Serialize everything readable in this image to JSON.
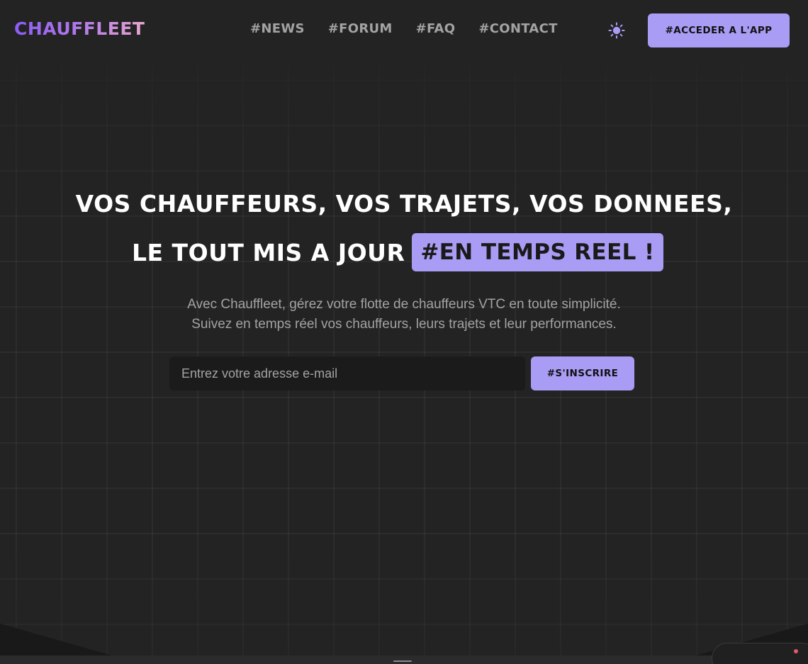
{
  "brand": {
    "logo": "CHAUFFLEET"
  },
  "nav": {
    "items": [
      {
        "label": "#NEWS"
      },
      {
        "label": "#FORUM"
      },
      {
        "label": "#FAQ"
      },
      {
        "label": "#CONTACT"
      }
    ],
    "theme_icon": "sun-icon",
    "app_button": "#ACCEDER A L'APP"
  },
  "hero": {
    "line1": "VOS CHAUFFEURS, VOS TRAJETS, VOS DONNEES,",
    "line2": "LE TOUT MIS A JOUR",
    "highlight": "#EN TEMPS REEL !",
    "subtitle_line1": "Avec Chauffleet, gérez votre flotte de chauffeurs VTC en toute simplicité.",
    "subtitle_line2": "Suivez en temps réel vos chauffeurs, leurs trajets et leur performances."
  },
  "signup": {
    "email_placeholder": "Entrez votre adresse e-mail",
    "email_value": "",
    "button": "#S'INSCRIRE"
  },
  "colors": {
    "accent": "#a99cf4",
    "background": "#232323",
    "muted_text": "#a3a3a3"
  }
}
